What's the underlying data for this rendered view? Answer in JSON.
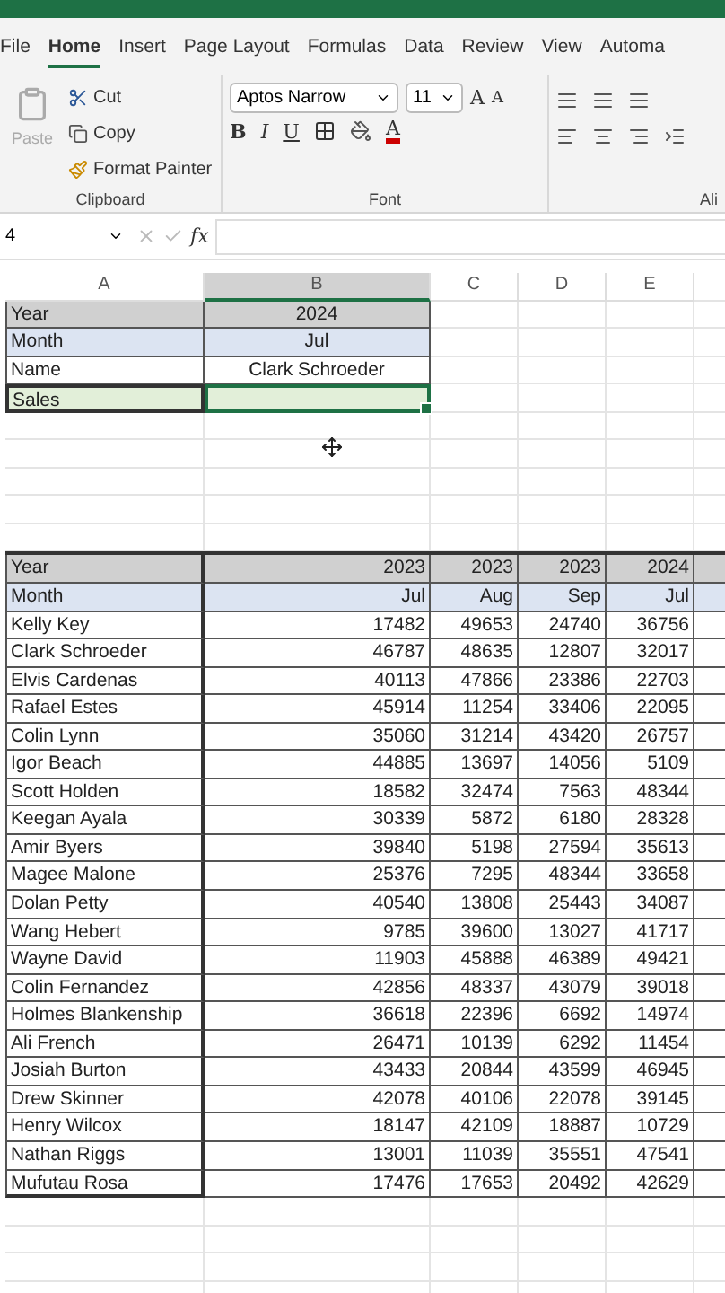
{
  "tabs": [
    {
      "label": "File",
      "selected": false
    },
    {
      "label": "Home",
      "selected": true
    },
    {
      "label": "Insert",
      "selected": false
    },
    {
      "label": "Page Layout",
      "selected": false
    },
    {
      "label": "Formulas",
      "selected": false
    },
    {
      "label": "Data",
      "selected": false
    },
    {
      "label": "Review",
      "selected": false
    },
    {
      "label": "View",
      "selected": false
    },
    {
      "label": "Automa",
      "selected": false
    }
  ],
  "clipboard": {
    "paste": "Paste",
    "cut": "Cut",
    "copy": "Copy",
    "format_painter": "Format Painter",
    "label": "Clipboard"
  },
  "font": {
    "font_name": "Aptos Narrow",
    "font_size": "11",
    "grow": "A",
    "shrink": "A",
    "bold": "B",
    "italic": "I",
    "underline": "U",
    "font_color": "A",
    "label": "Font"
  },
  "alignment": {
    "label": "Ali"
  },
  "formula_bar": {
    "name_box": "4",
    "fx": "fx"
  },
  "columns": [
    {
      "label": "A",
      "selected": false
    },
    {
      "label": "B",
      "selected": true
    },
    {
      "label": "C",
      "selected": false
    },
    {
      "label": "D",
      "selected": false
    },
    {
      "label": "E",
      "selected": false
    }
  ],
  "lookup": [
    {
      "label": "Year",
      "value": "2024",
      "kind": "header",
      "selected": false
    },
    {
      "label": "Month",
      "value": "Jul",
      "kind": "month",
      "selected": false
    },
    {
      "label": "Name",
      "value": "Clark Schroeder",
      "kind": "plain",
      "selected": false
    },
    {
      "label": "Sales",
      "kind": "input",
      "selected": true
    }
  ],
  "sales_table": {
    "years": {
      "label": "Year",
      "values": [
        "2023",
        "2023",
        "2023",
        "2024"
      ]
    },
    "months": {
      "label": "Month",
      "values": [
        "Jul",
        "Aug",
        "Sep",
        "Jul"
      ]
    },
    "rows": [
      {
        "name": "Kelly Key",
        "values": [
          "17482",
          "49653",
          "24740",
          "36756"
        ]
      },
      {
        "name": "Clark Schroeder",
        "values": [
          "46787",
          "48635",
          "12807",
          "32017"
        ]
      },
      {
        "name": "Elvis Cardenas",
        "values": [
          "40113",
          "47866",
          "23386",
          "22703"
        ]
      },
      {
        "name": "Rafael Estes",
        "values": [
          "45914",
          "11254",
          "33406",
          "22095"
        ]
      },
      {
        "name": "Colin Lynn",
        "values": [
          "35060",
          "31214",
          "43420",
          "26757"
        ]
      },
      {
        "name": "Igor Beach",
        "values": [
          "44885",
          "13697",
          "14056",
          "5109"
        ]
      },
      {
        "name": "Scott Holden",
        "values": [
          "18582",
          "32474",
          "7563",
          "48344"
        ]
      },
      {
        "name": "Keegan Ayala",
        "values": [
          "30339",
          "5872",
          "6180",
          "28328"
        ]
      },
      {
        "name": "Amir Byers",
        "values": [
          "39840",
          "5198",
          "27594",
          "35613"
        ]
      },
      {
        "name": "Magee Malone",
        "values": [
          "25376",
          "7295",
          "48344",
          "33658"
        ]
      },
      {
        "name": "Dolan Petty",
        "values": [
          "40540",
          "13808",
          "25443",
          "34087"
        ]
      },
      {
        "name": "Wang Hebert",
        "values": [
          "9785",
          "39600",
          "13027",
          "41717"
        ]
      },
      {
        "name": "Wayne David",
        "values": [
          "11903",
          "45888",
          "46389",
          "49421"
        ]
      },
      {
        "name": "Colin Fernandez",
        "values": [
          "42856",
          "48337",
          "43079",
          "39018"
        ]
      },
      {
        "name": "Holmes Blankenship",
        "values": [
          "36618",
          "22396",
          "6692",
          "14974"
        ]
      },
      {
        "name": "Ali French",
        "values": [
          "26471",
          "10139",
          "6292",
          "11454"
        ]
      },
      {
        "name": "Josiah Burton",
        "values": [
          "43433",
          "20844",
          "43599",
          "46945"
        ]
      },
      {
        "name": "Drew Skinner",
        "values": [
          "42078",
          "40106",
          "22078",
          "39145"
        ]
      },
      {
        "name": "Henry Wilcox",
        "values": [
          "18147",
          "42109",
          "18887",
          "10729"
        ]
      },
      {
        "name": "Nathan Riggs",
        "values": [
          "13001",
          "11039",
          "35551",
          "47541"
        ]
      },
      {
        "name": "Mufutau Rosa",
        "values": [
          "17476",
          "17653",
          "20492",
          "42629"
        ]
      }
    ]
  }
}
